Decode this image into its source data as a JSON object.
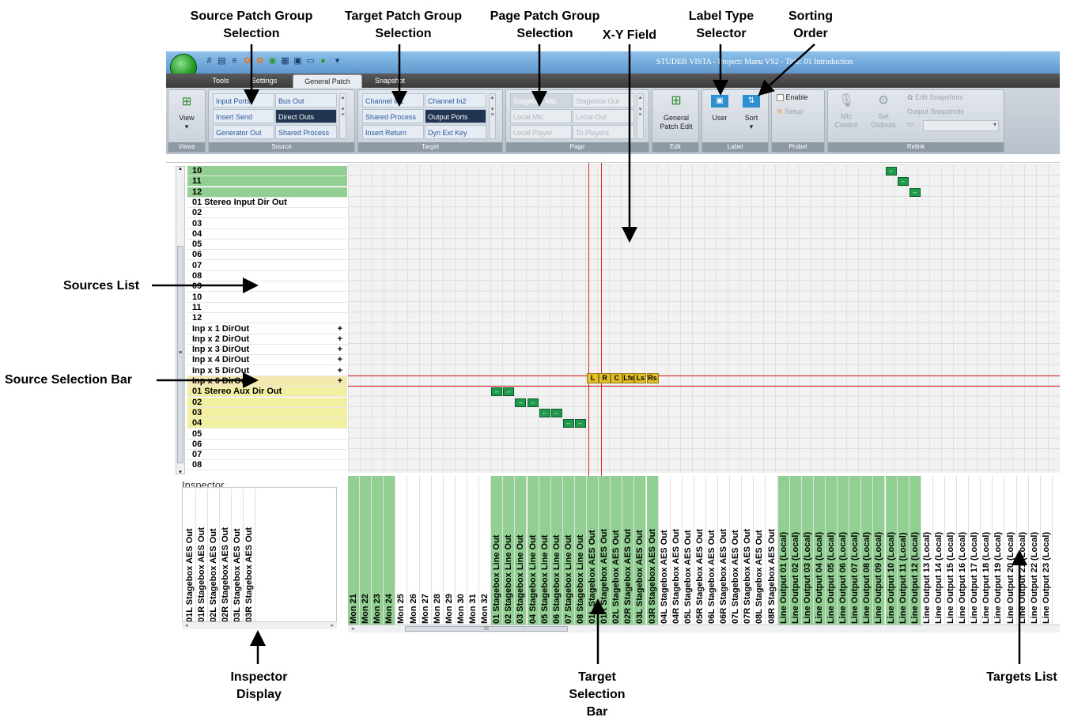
{
  "callouts": {
    "source_patch_group": "Source Patch Group Selection",
    "target_patch_group": "Target Patch Group Selection",
    "page_patch_group": "Page Patch Group Selection",
    "xy_field": "X-Y Field",
    "label_type": "Label Type Selector",
    "sorting_order": "Sorting Order",
    "sources_list": "Sources List",
    "source_selection_bar": "Source Selection Bar",
    "inspector_display": "Inspector Display",
    "target_selection_bar": "Target Selection Bar",
    "targets_list": "Targets List"
  },
  "window": {
    "title": "STUDER VISTA - Project: Manu VS2 - Title: 01 Introduction"
  },
  "tabs": [
    "Tools",
    "Settings",
    "General Patch",
    "Snapshot"
  ],
  "ribbon": {
    "views": {
      "button": "View",
      "group": "Views"
    },
    "source": {
      "group": "Source",
      "buttons": [
        "Input Ports",
        "Bus Out",
        "Insert Send",
        "Direct Outs",
        "Generator Out",
        "Shared Process"
      ]
    },
    "target": {
      "group": "Target",
      "buttons": [
        "Channel In1",
        "Channel In2",
        "Shared Process",
        "Output Ports",
        "Insert Return",
        "Dyn Ext Key"
      ]
    },
    "page": {
      "group": "Page",
      "buttons": [
        "Stagebox Mic",
        "Stagebox Out",
        "Local Mic",
        "Local Out",
        "Local Player",
        "To Players"
      ]
    },
    "edit": {
      "group": "Edit",
      "button": "General Patch Edit"
    },
    "label": {
      "group": "Label",
      "user": "User",
      "sort": "Sort"
    },
    "probel": {
      "group": "Probel",
      "enable": "Enable",
      "setup": "Setup"
    },
    "relink": {
      "group": "Relink",
      "mic": "Mic Control",
      "set": "Set Outputs",
      "edit_snap": "Edit Snapshots",
      "out_snap": "Output Snapshots"
    }
  },
  "sources": [
    "10",
    "11",
    "12",
    "01 Stereo Input Dir Out",
    "02",
    "03",
    "04",
    "05",
    "06",
    "07",
    "08",
    "09",
    "10",
    "11",
    "12",
    "Inp x  1 DirOut",
    "Inp x  2 DirOut",
    "Inp x  3 DirOut",
    "Inp x  4 DirOut",
    "Inp x  5 DirOut",
    "Inp x  6 DirOut",
    "01 Stereo Aux Dir Out",
    "02",
    "03",
    "04",
    "05",
    "06",
    "07",
    "08"
  ],
  "channel_labels": [
    "L",
    "R",
    "C",
    "Lfe",
    "Ls",
    "Rs"
  ],
  "inspector": {
    "title": "Inspector",
    "items": [
      "01L Stagebox AES Out",
      "01R Stagebox AES Out",
      "02L Stagebox AES Out",
      "02R Stagebox AES Out",
      "03L Stagebox AES Out",
      "03R Stagebox AES Out"
    ]
  },
  "targets": [
    "Mon 21",
    "Mon 22",
    "Mon 23",
    "Mon 24",
    "Mon 25",
    "Mon 26",
    "Mon 27",
    "Mon 28",
    "Mon 29",
    "Mon 30",
    "Mon 31",
    "Mon 32",
    "01 Stagebox Line Out",
    "02 Stagebox Line Out",
    "03 Stagebox Line Out",
    "04 Stagebox Line Out",
    "05 Stagebox Line Out",
    "06 Stagebox Line Out",
    "07 Stagebox Line Out",
    "08 Stagebox Line Out",
    "01L Stagebox AES Out",
    "01R Stagebox AES Out",
    "02L Stagebox AES Out",
    "02R Stagebox AES Out",
    "03L Stagebox AES Out",
    "03R Stagebox AES Out",
    "04L Stagebox AES Out",
    "04R Stagebox AES Out",
    "05L Stagebox AES Out",
    "05R Stagebox AES Out",
    "06L Stagebox AES Out",
    "06R Stagebox AES Out",
    "07L Stagebox AES Out",
    "07R Stagebox AES Out",
    "08L Stagebox AES Out",
    "08R Stagebox AES Out",
    "Line Output 01 (Local)",
    "Line Output 02 (Local)",
    "Line Output 03 (Local)",
    "Line Output 04 (Local)",
    "Line Output 05 (Local)",
    "Line Output 06 (Local)",
    "Line Output 07 (Local)",
    "Line Output 08 (Local)",
    "Line Output 09 (Local)",
    "Line Output 10 (Local)",
    "Line Output 11 (Local)",
    "Line Output 12 (Local)",
    "Line Output 13 (Local)",
    "Line Output 14 (Local)",
    "Line Output 15 (Local)",
    "Line Output 16 (Local)",
    "Line Output 17 (Local)",
    "Line Output 18 (Local)",
    "Line Output 19 (Local)",
    "Line Output 20 (Local)",
    "Line Output 21 (Local)",
    "Line Output 22 (Local)",
    "Line Output 23 (Local)"
  ],
  "scrollbar_label": "III"
}
